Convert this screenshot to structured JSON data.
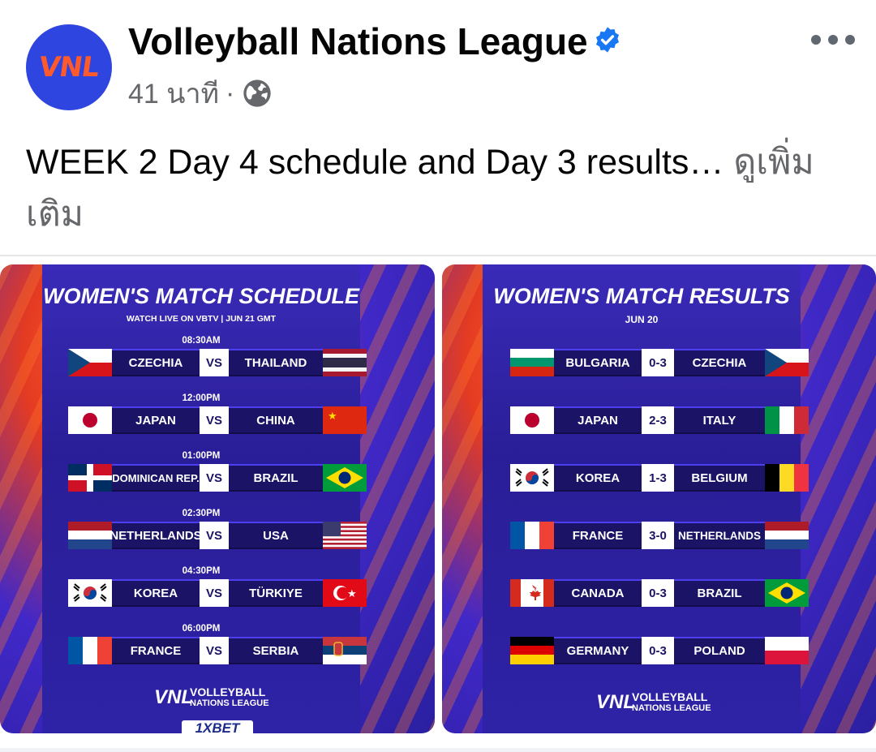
{
  "post": {
    "page_name": "Volleyball Nations League",
    "avatar_text": "VNL",
    "time": "41 นาที",
    "separator": "·",
    "text": "WEEK 2 Day 4 schedule and Day 3 results… ",
    "see_more": "ดูเพิ่มเติม"
  },
  "schedule": {
    "title": "WOMEN'S MATCH SCHEDULE",
    "subtitle": "WATCH LIVE ON VBTV | JUN 21 GMT",
    "vs_label": "VS",
    "matches": [
      {
        "time": "08:30AM",
        "home": "CZECHIA",
        "away": "THAILAND"
      },
      {
        "time": "12:00PM",
        "home": "JAPAN",
        "away": "CHINA"
      },
      {
        "time": "01:00PM",
        "home": "DOMINICAN REP.",
        "away": "BRAZIL"
      },
      {
        "time": "02:30PM",
        "home": "NETHERLANDS",
        "away": "USA"
      },
      {
        "time": "04:30PM",
        "home": "KOREA",
        "away": "TÜRKIYE"
      },
      {
        "time": "06:00PM",
        "home": "FRANCE",
        "away": "SERBIA"
      }
    ],
    "brand_logo": "VNL",
    "brand_line1": "VOLLEYBALL",
    "brand_line2": "NATIONS LEAGUE",
    "sponsor": "1XBET"
  },
  "results": {
    "title": "WOMEN'S MATCH RESULTS",
    "subtitle": "JUN 20",
    "matches": [
      {
        "home": "BULGARIA",
        "score": "0-3",
        "away": "CZECHIA"
      },
      {
        "home": "JAPAN",
        "score": "2-3",
        "away": "ITALY"
      },
      {
        "home": "KOREA",
        "score": "1-3",
        "away": "BELGIUM"
      },
      {
        "home": "FRANCE",
        "score": "3-0",
        "away": "NETHERLANDS"
      },
      {
        "home": "CANADA",
        "score": "0-3",
        "away": "BRAZIL"
      },
      {
        "home": "GERMANY",
        "score": "0-3",
        "away": "POLAND"
      }
    ],
    "brand_logo": "VNL",
    "brand_line1": "VOLLEYBALL",
    "brand_line2": "NATIONS LEAGUE"
  },
  "colors": {
    "verified": "#1877f2",
    "avatar_bg": "#2f45e0",
    "secondary_text": "#65676b"
  }
}
